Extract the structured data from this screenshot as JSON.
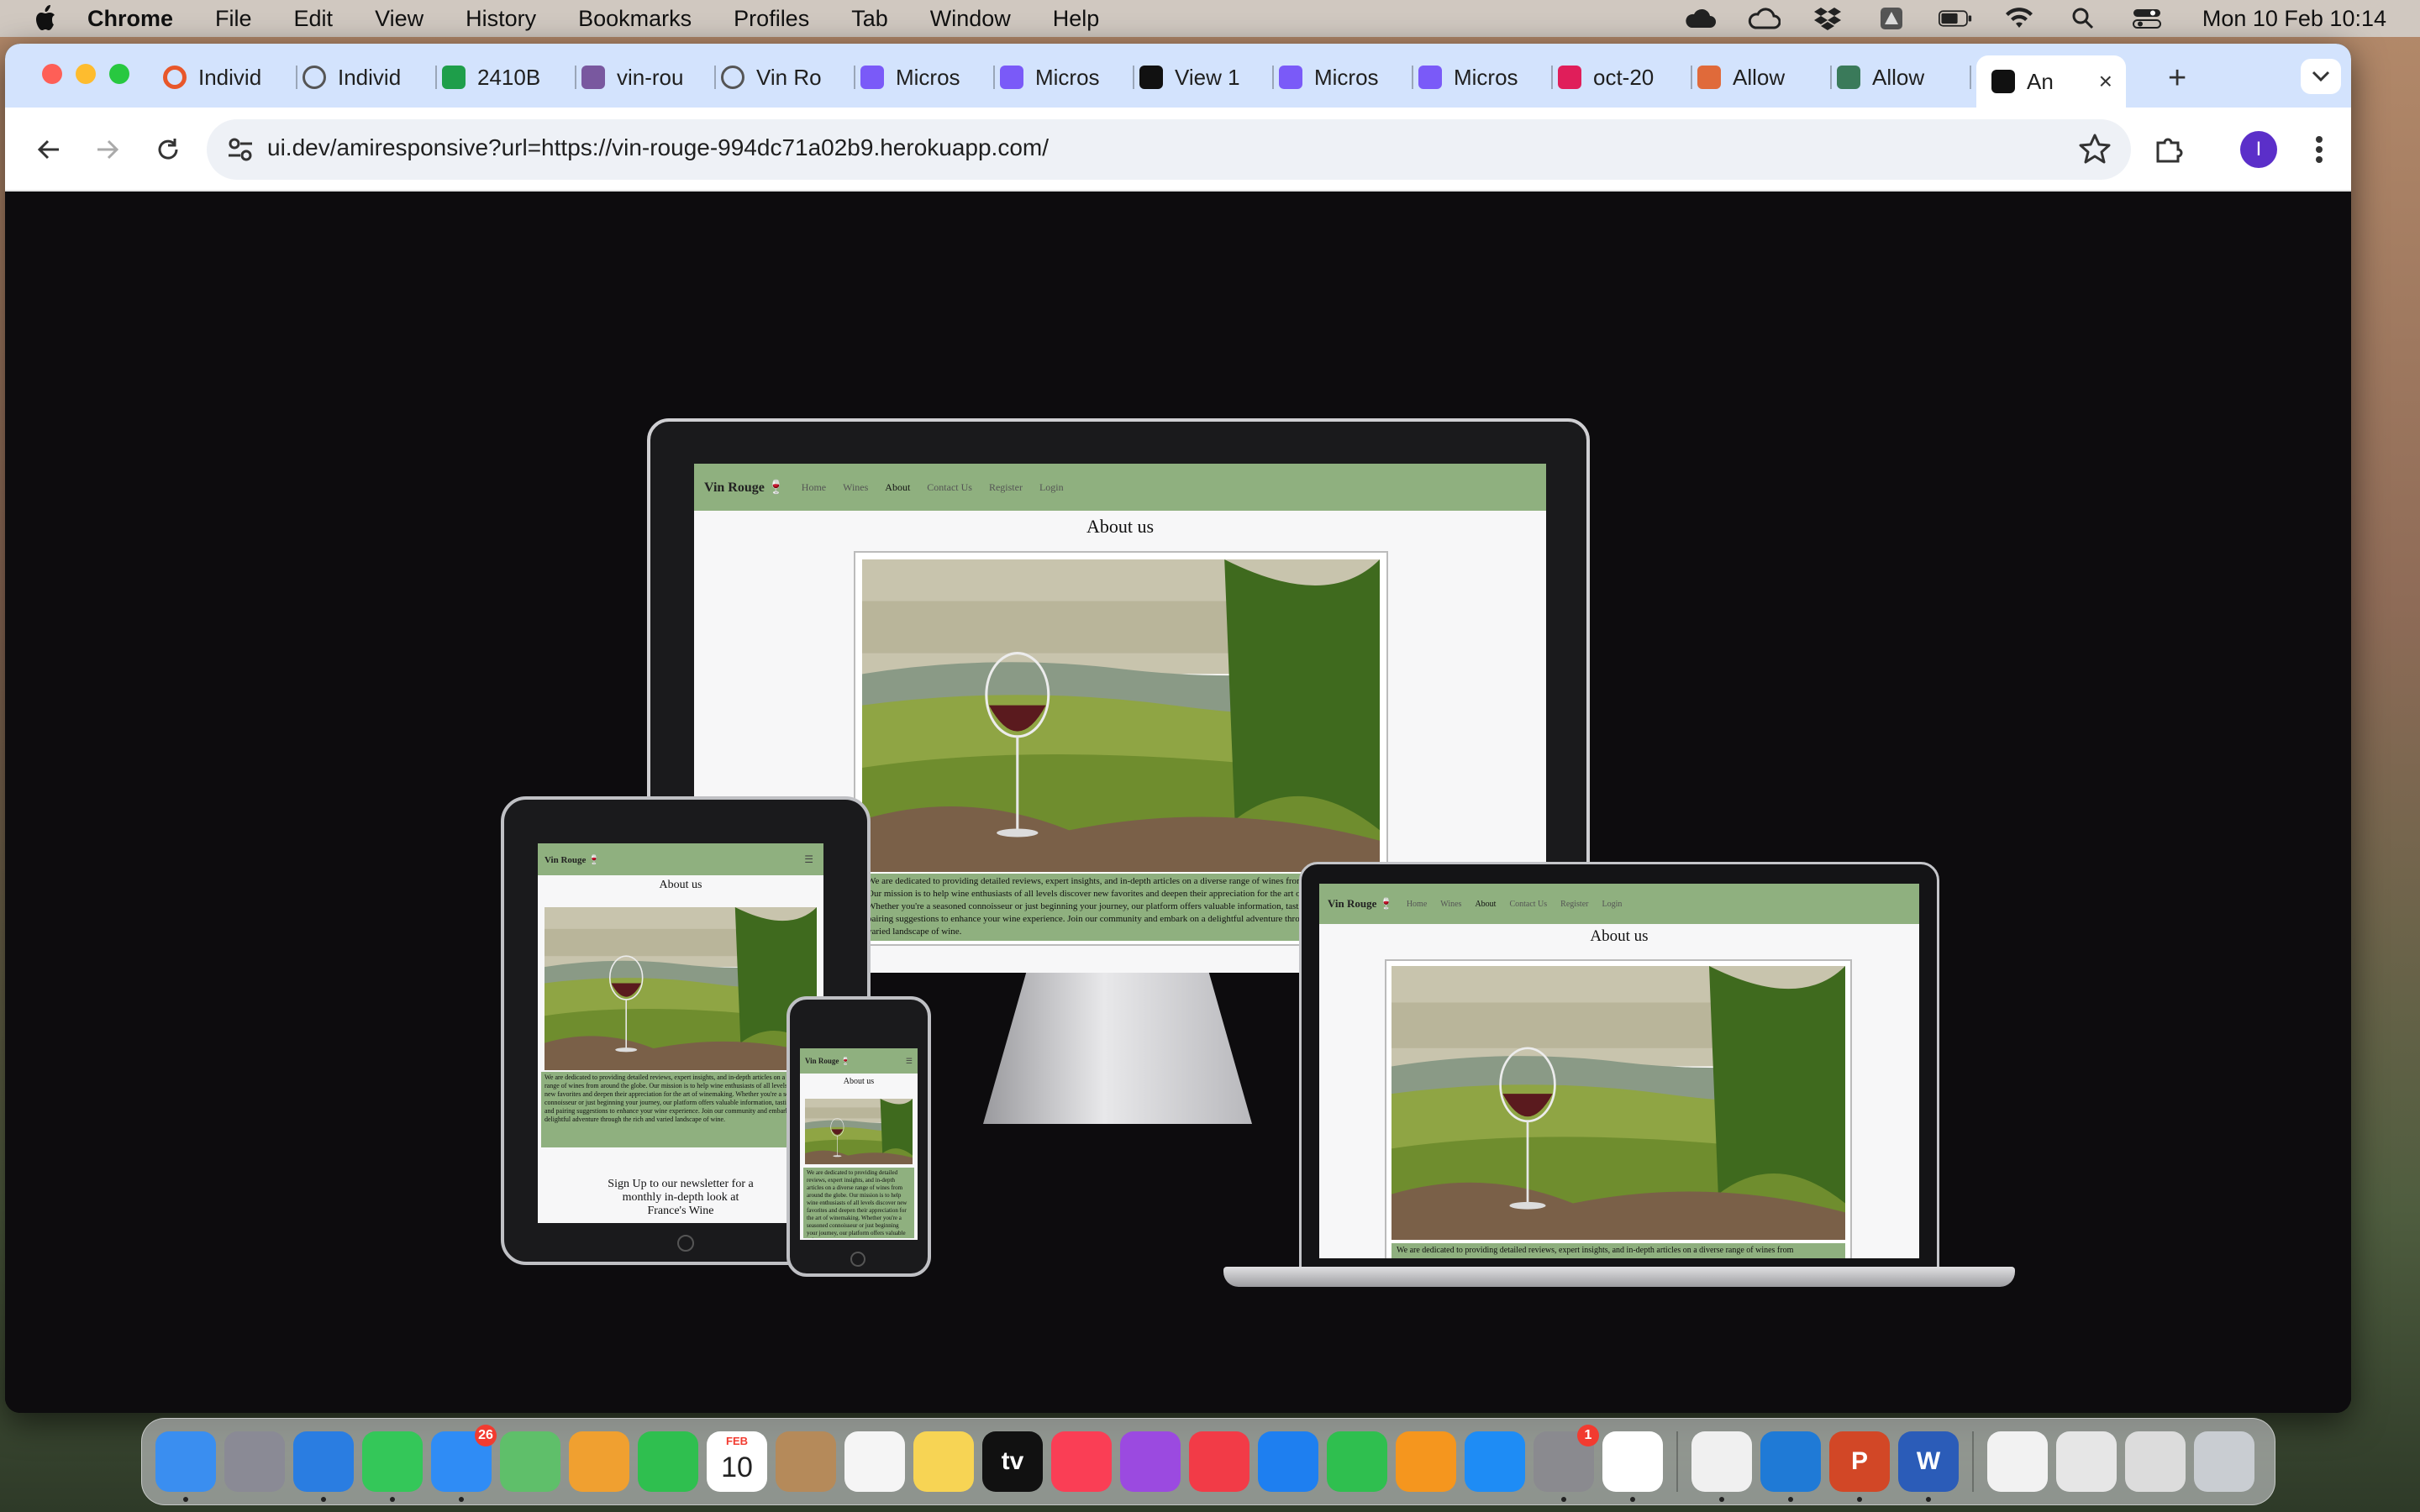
{
  "menubar": {
    "app_name": "Chrome",
    "items": [
      "File",
      "Edit",
      "View",
      "History",
      "Bookmarks",
      "Profiles",
      "Tab",
      "Window",
      "Help"
    ],
    "clock": "Mon 10 Feb  10:14",
    "status_icons": [
      "icloud-icon",
      "cloud-icon",
      "dropbox-icon",
      "drive-icon",
      "battery-icon",
      "wifi-icon",
      "spotlight-icon",
      "control-center-icon"
    ]
  },
  "tabs": [
    {
      "title": "Individ",
      "icon": "red-ring-icon",
      "color": "#e8572a"
    },
    {
      "title": "Individ",
      "icon": "globe-icon",
      "color": "#555555"
    },
    {
      "title": "2410B",
      "icon": "sheets-icon",
      "color": "#1e9e4a"
    },
    {
      "title": "vin-rou",
      "icon": "heroku-icon",
      "color": "#79589f"
    },
    {
      "title": "Vin Ro",
      "icon": "globe-icon",
      "color": "#555555"
    },
    {
      "title": "Micros",
      "icon": "copilot-icon",
      "color": "#7a5af8"
    },
    {
      "title": "Micros",
      "icon": "copilot-icon",
      "color": "#7a5af8"
    },
    {
      "title": "View 1",
      "icon": "github-icon",
      "color": "#111111"
    },
    {
      "title": "Micros",
      "icon": "copilot-icon",
      "color": "#7a5af8"
    },
    {
      "title": "Micros",
      "icon": "copilot-icon",
      "color": "#7a5af8"
    },
    {
      "title": "oct-20",
      "icon": "slack-icon",
      "color": "#e01e5a"
    },
    {
      "title": "Allow",
      "icon": "rainbow-icon",
      "color": "#e06a3a"
    },
    {
      "title": "Allow",
      "icon": "window-icon",
      "color": "#3a7a5a"
    },
    {
      "title": "An",
      "icon": "ui-dev-icon",
      "color": "#111111",
      "active": true
    }
  ],
  "address_bar": {
    "url": "ui.dev/amiresponsive?url=https://vin-rouge-994dc71a02b9.herokuapp.com/"
  },
  "profile": {
    "initial": "I"
  },
  "site": {
    "brand": "Vin Rouge 🍷",
    "nav": [
      "Home",
      "Wines",
      "About",
      "Contact Us",
      "Register",
      "Login"
    ],
    "current_nav": "About",
    "heading": "About us",
    "body": "We are dedicated to providing detailed reviews, expert insights, and in-depth articles on a diverse range of wines from around the globe. Our mission is to help wine enthusiasts of all levels discover new favorites and deepen their appreciation for the art of winemaking. Whether you're a seasoned connoisseur or just beginning your journey, our platform offers valuable information, tasting notes, and pairing suggestions to enhance your wine experience. Join our community and embark on a delightful adventure through the rich and varied landscape of wine.",
    "desktop_body": "We are dedicated to providing detailed reviews, expert insights, and in-depth articles on a diverse range of wines from around the globe. Our mission is to help wine enthusiasts of all levels discover new favorites and deepen their appreciation for the art of winemaking. Whether you're a seasoned connoisseur or just beginning your journey, our platform offers valuable information, tasting notes, and pairing suggestions to enhance your wine experience. Join our community and embark on a delightful adventure through the rich and varied landscape of wine.",
    "laptop_body": "We are dedicated to providing detailed reviews, expert insights, and in-depth articles on a diverse range of wines from",
    "newsletter": "Sign Up to our newsletter for a monthly in-depth look at France's Wine",
    "menu_icon": "hamburger-icon"
  },
  "dock": [
    {
      "name": "finder-icon",
      "color": "#3a8ef0"
    },
    {
      "name": "launchpad-icon",
      "color": "#8a8a95"
    },
    {
      "name": "safari-icon",
      "color": "#2a7de1"
    },
    {
      "name": "messages-icon",
      "color": "#34c759"
    },
    {
      "name": "mail-icon",
      "color": "#2f8cf5",
      "badge": "26"
    },
    {
      "name": "maps-icon",
      "color": "#5fbf6a"
    },
    {
      "name": "photos-icon",
      "color": "#f0a030"
    },
    {
      "name": "facetime-icon",
      "color": "#2fbf4f"
    },
    {
      "name": "calendar-icon",
      "color": "#ffffff",
      "label": "10",
      "sublabel": "FEB"
    },
    {
      "name": "contacts-icon",
      "color": "#b58a5a"
    },
    {
      "name": "reminders-icon",
      "color": "#f5f5f5"
    },
    {
      "name": "notes-icon",
      "color": "#f7d454"
    },
    {
      "name": "appletv-icon",
      "color": "#111111",
      "label": "tv"
    },
    {
      "name": "music-icon",
      "color": "#fa3e55"
    },
    {
      "name": "podcasts-icon",
      "color": "#9b4ae0"
    },
    {
      "name": "news-icon",
      "color": "#f23b47"
    },
    {
      "name": "keynote-icon",
      "color": "#1e7ff0"
    },
    {
      "name": "numbers-icon",
      "color": "#2fbf4f"
    },
    {
      "name": "pages-icon",
      "color": "#f5961e"
    },
    {
      "name": "appstore-icon",
      "color": "#1e8cf5"
    },
    {
      "name": "system-settings-icon",
      "color": "#8a8a8f",
      "badge": "1"
    },
    {
      "name": "chrome-icon",
      "color": "#ffffff"
    },
    {
      "name": "divider"
    },
    {
      "name": "face-app-icon",
      "color": "#f0f0f0"
    },
    {
      "name": "vscode-icon",
      "color": "#1f7ad6"
    },
    {
      "name": "powerpoint-icon",
      "color": "#d24726",
      "label": "P"
    },
    {
      "name": "word-icon",
      "color": "#2b5cb8",
      "label": "W"
    },
    {
      "name": "divider"
    },
    {
      "name": "recent-doc-1-icon",
      "color": "#f2f2f2"
    },
    {
      "name": "recent-doc-2-icon",
      "color": "#e6e6e6"
    },
    {
      "name": "recent-doc-3-icon",
      "color": "#dcdcdc"
    },
    {
      "name": "trash-icon",
      "color": "#c9cdd2"
    }
  ]
}
